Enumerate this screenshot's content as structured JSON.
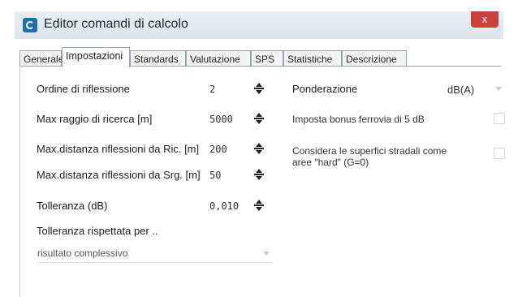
{
  "window": {
    "title": "Editor comandi di calcolo",
    "close_label": "x"
  },
  "tabs": [
    {
      "label": "Generale"
    },
    {
      "label": "Impostazioni"
    },
    {
      "label": "Standards"
    },
    {
      "label": "Valutazione"
    },
    {
      "label": "SPS"
    },
    {
      "label": "Statistiche"
    },
    {
      "label": "Descrizione"
    }
  ],
  "settings": [
    {
      "label": "Ordine di riflessione",
      "value": "2"
    },
    {
      "label": "Max raggio di ricerca [m]",
      "value": "5000"
    },
    {
      "label": "Max.distanza riflessioni da Ric. [m]",
      "value": "200"
    },
    {
      "label": "Max.distanza riflessioni da Srg. [m]",
      "value": "50"
    },
    {
      "label": "Tolleranza (dB)",
      "value": "0,010"
    }
  ],
  "tolerance": {
    "label": "Tolleranza rispettata per ..",
    "selected": "risultato complessivo"
  },
  "right": {
    "ponderazione_label": "Ponderazione",
    "ponderazione_value": "dB(A)",
    "bonus_label": "Imposta bonus ferrovia di 5 dB",
    "hard_label_line1": "Considera le superfici stradali come",
    "hard_label_line2": "aree \"hard\" (G=0)"
  }
}
